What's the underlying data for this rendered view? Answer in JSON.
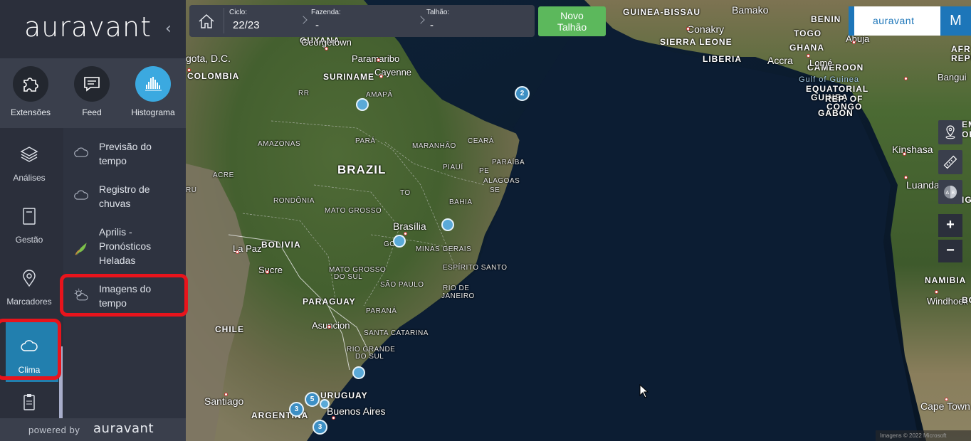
{
  "app": {
    "brand": "auravant",
    "powered_by": "powered by",
    "powered_brand": "auravant"
  },
  "extensions": [
    {
      "label": "Extensões",
      "icon": "puzzle-icon"
    },
    {
      "label": "Feed",
      "icon": "chat-icon"
    },
    {
      "label": "Histograma",
      "icon": "histogram-icon"
    }
  ],
  "nav": [
    {
      "label": "Análises",
      "icon": "layers-icon"
    },
    {
      "label": "Gestão",
      "icon": "notebook-icon"
    },
    {
      "label": "Marcadores",
      "icon": "location-pin-icon"
    },
    {
      "label": "Clima",
      "icon": "cloud-icon"
    }
  ],
  "submenu": [
    {
      "label": "Previsão do\ntempo",
      "icon": "cloud-icon"
    },
    {
      "label": "Registro de\nchuvas",
      "icon": "cloud-icon"
    },
    {
      "label": "Aprilis -\nPronósticos\nHeladas",
      "icon": "sprout-icon"
    },
    {
      "label": "Imagens do\ntempo",
      "icon": "satellite-weather-icon"
    }
  ],
  "toolbar": {
    "ciclo_label": "Ciclo:",
    "ciclo_value": "22/23",
    "fazenda_label": "Fazenda:",
    "fazenda_value": "-",
    "talhao_label": "Talhão:",
    "talhao_value": "-",
    "new_plot_label": "Novo\nTalhão"
  },
  "header": {
    "brand": "auravant",
    "user_initial": "M"
  },
  "map_controls": {
    "zoom_in": "+",
    "zoom_out": "−",
    "copyright": "Imagens © 2022 Microsoft"
  },
  "map": {
    "labels": [
      {
        "text": "GUYANA",
        "cls": "lbl-country"
      },
      {
        "text": "SURINAME",
        "cls": "lbl-country"
      },
      {
        "text": "COLOMBIA",
        "cls": "lbl-country"
      },
      {
        "text": "BRAZIL",
        "cls": "lbl-big"
      },
      {
        "text": "BOLIVIA",
        "cls": "lbl-country"
      },
      {
        "text": "PARAGUAY",
        "cls": "lbl-country"
      },
      {
        "text": "CHILE",
        "cls": "lbl-country"
      },
      {
        "text": "URUGUAY",
        "cls": "lbl-country"
      },
      {
        "text": "ARGENTINA",
        "cls": "lbl-country"
      },
      {
        "text": "GUINEA-BISSAU",
        "cls": "lbl-country"
      },
      {
        "text": "SIERRA LEONE",
        "cls": "lbl-country"
      },
      {
        "text": "LIBERIA",
        "cls": "lbl-country"
      },
      {
        "text": "BENIN",
        "cls": "lbl-country"
      },
      {
        "text": "TOGO",
        "cls": "lbl-country"
      },
      {
        "text": "GHANA",
        "cls": "lbl-country"
      },
      {
        "text": "CAMEROON",
        "cls": "lbl-country"
      },
      {
        "text": "EQUATORIAL",
        "cls": "lbl-country"
      },
      {
        "text": "GUINEA",
        "cls": "lbl-country"
      },
      {
        "text": "REP. OF",
        "cls": "lbl-country"
      },
      {
        "text": "CONGO",
        "cls": "lbl-country"
      },
      {
        "text": "GABON",
        "cls": "lbl-country"
      },
      {
        "text": "NAMIBIA",
        "cls": "lbl-country"
      },
      {
        "text": "Georgetown",
        "cls": "lbl-city"
      },
      {
        "text": "Paramaribo",
        "cls": "lbl-city"
      },
      {
        "text": "Cayenne",
        "cls": "lbl-city"
      },
      {
        "text": "gota, D.C.",
        "cls": "lbl-cityb"
      },
      {
        "text": "Brasília",
        "cls": "lbl-cityb"
      },
      {
        "text": "La Paz",
        "cls": "lbl-city"
      },
      {
        "text": "Sucre",
        "cls": "lbl-city"
      },
      {
        "text": "Asuncion",
        "cls": "lbl-city"
      },
      {
        "text": "Santiago",
        "cls": "lbl-cityb"
      },
      {
        "text": "Buenos Aires",
        "cls": "lbl-cityb"
      },
      {
        "text": "Bamako",
        "cls": "lbl-cityb"
      },
      {
        "text": "Conakry",
        "cls": "lbl-cityb"
      },
      {
        "text": "Accra",
        "cls": "lbl-cityb"
      },
      {
        "text": "Lomé",
        "cls": "lbl-city"
      },
      {
        "text": "Abuja",
        "cls": "lbl-city"
      },
      {
        "text": "Bangui",
        "cls": "lbl-city"
      },
      {
        "text": "Kinshasa",
        "cls": "lbl-cityb"
      },
      {
        "text": "Luanda",
        "cls": "lbl-cityb"
      },
      {
        "text": "Windhoek",
        "cls": "lbl-city"
      },
      {
        "text": "Cape Town",
        "cls": "lbl-cityb"
      },
      {
        "text": "Gulf of Guinea",
        "cls": "lbl-sea"
      },
      {
        "text": "AMAPÁ",
        "cls": "lbl-state"
      },
      {
        "text": "RR",
        "cls": "lbl-state"
      },
      {
        "text": "AMAZONAS",
        "cls": "lbl-state"
      },
      {
        "text": "PARÁ",
        "cls": "lbl-state"
      },
      {
        "text": "MARANHÃO",
        "cls": "lbl-state"
      },
      {
        "text": "CEARÁ",
        "cls": "lbl-state"
      },
      {
        "text": "PARAÍBA",
        "cls": "lbl-state"
      },
      {
        "text": "PIAUÍ",
        "cls": "lbl-state"
      },
      {
        "text": "PE",
        "cls": "lbl-state"
      },
      {
        "text": "ALAGOAS",
        "cls": "lbl-state"
      },
      {
        "text": "SE",
        "cls": "lbl-state"
      },
      {
        "text": "ACRE",
        "cls": "lbl-state"
      },
      {
        "text": "RU",
        "cls": "lbl-state"
      },
      {
        "text": "RONDÔNIA",
        "cls": "lbl-state"
      },
      {
        "text": "TO",
        "cls": "lbl-state"
      },
      {
        "text": "BAHIA",
        "cls": "lbl-state"
      },
      {
        "text": "MATO GROSSO",
        "cls": "lbl-state"
      },
      {
        "text": "GO",
        "cls": "lbl-state"
      },
      {
        "text": "MINAS GERAIS",
        "cls": "lbl-state"
      },
      {
        "text": "ESPÍRITO SANTO",
        "cls": "lbl-state"
      },
      {
        "text": "MATO GROSSO",
        "cls": "lbl-state"
      },
      {
        "text": "DO SUL",
        "cls": "lbl-state"
      },
      {
        "text": "SÃO PAULO",
        "cls": "lbl-state"
      },
      {
        "text": "RIO DE",
        "cls": "lbl-state"
      },
      {
        "text": "JANEIRO",
        "cls": "lbl-state"
      },
      {
        "text": "PARANÁ",
        "cls": "lbl-state"
      },
      {
        "text": "SANTA CATARINA",
        "cls": "lbl-state"
      },
      {
        "text": "RIO GRANDE",
        "cls": "lbl-state"
      },
      {
        "text": "DO SUL",
        "cls": "lbl-state"
      },
      {
        "text": "AFR",
        "cls": "lbl-country"
      },
      {
        "text": "REPU",
        "cls": "lbl-country"
      },
      {
        "text": "ANG",
        "cls": "lbl-country"
      },
      {
        "text": "BO",
        "cls": "lbl-country"
      },
      {
        "text": "EM",
        "cls": "lbl-country"
      },
      {
        "text": "OF",
        "cls": "lbl-country"
      }
    ],
    "clusters": [
      {
        "count": "2"
      },
      {
        "count": "5"
      },
      {
        "count": "3"
      },
      {
        "count": "3"
      }
    ]
  }
}
